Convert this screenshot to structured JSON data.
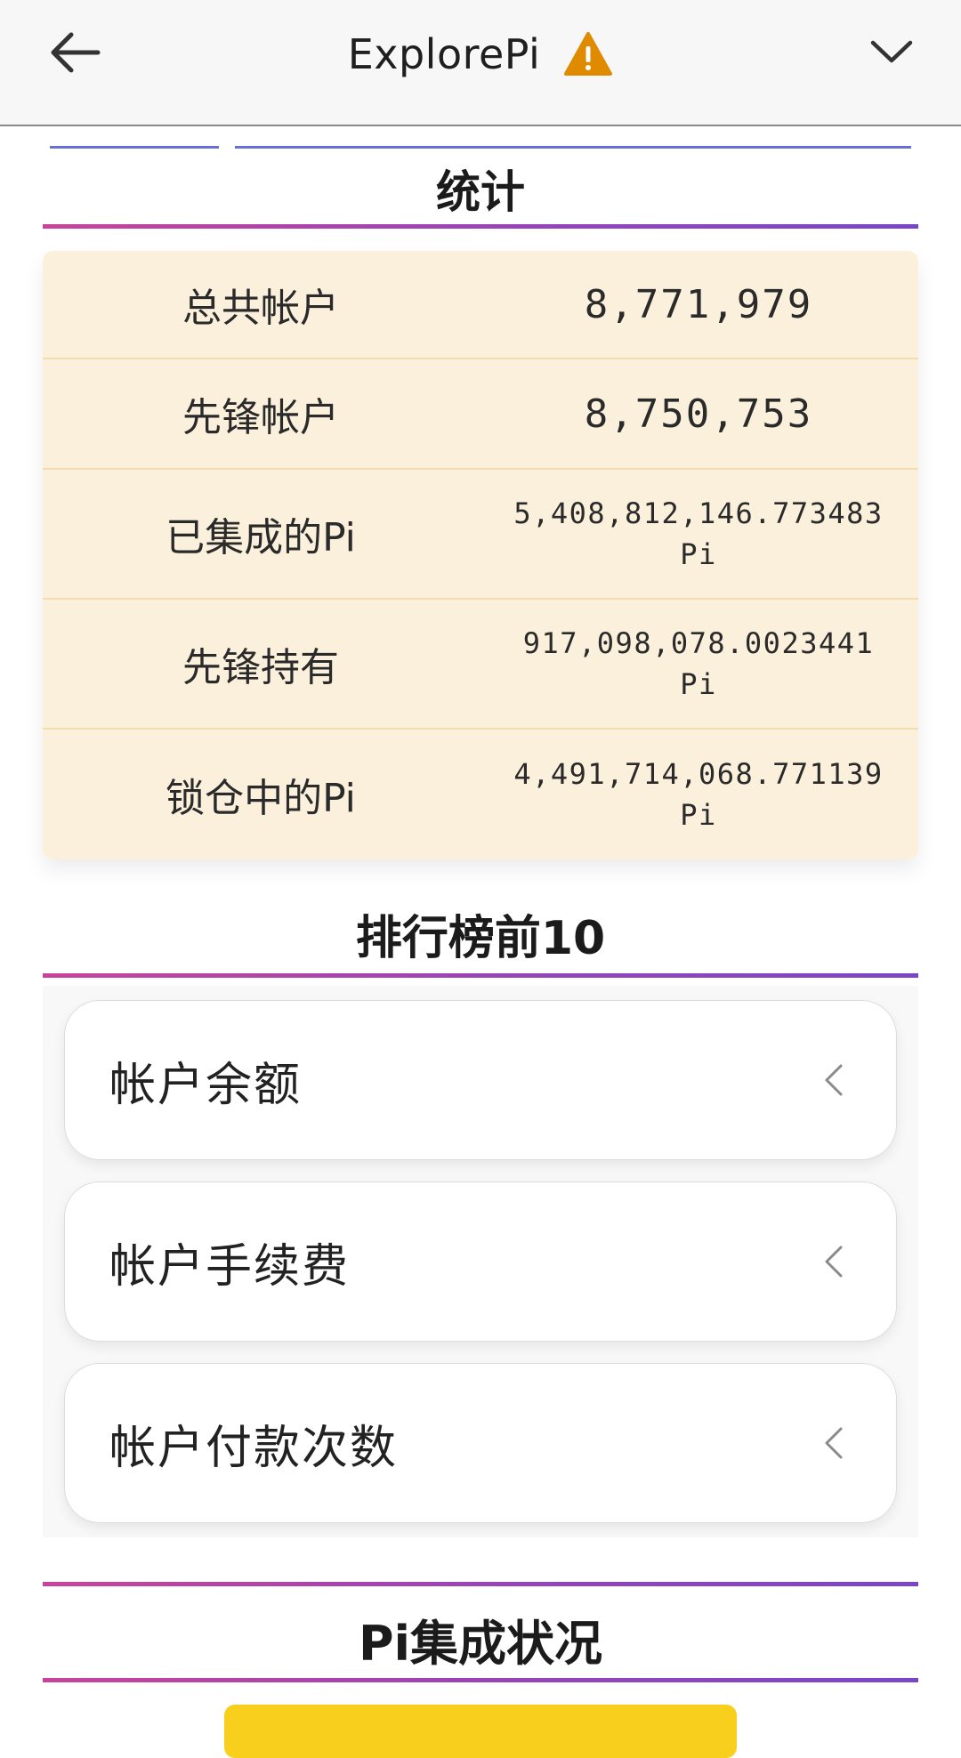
{
  "header": {
    "title": "ExplorePi",
    "back_icon": "arrow-left-icon",
    "warning_icon": "warning-icon",
    "menu_icon": "chevron-down-icon"
  },
  "stats": {
    "title": "统计",
    "rows": [
      {
        "label": "总共帐户",
        "value": "8,771,979"
      },
      {
        "label": "先锋帐户",
        "value": "8,750,753"
      },
      {
        "label": "已集成的Pi",
        "value": "5,408,812,146.773483",
        "unit": "Pi"
      },
      {
        "label": "先锋持有",
        "value": "917,098,078.0023441",
        "unit": "Pi"
      },
      {
        "label": "锁仓中的Pi",
        "value": "4,491,714,068.771139",
        "unit": "Pi"
      }
    ]
  },
  "leaderboard": {
    "title": "排行榜前10",
    "items": [
      {
        "label": "帐户余额"
      },
      {
        "label": "帐户手续费"
      },
      {
        "label": "帐户付款次数"
      }
    ]
  },
  "integration": {
    "title": "Pi集成状况"
  },
  "colors": {
    "accent_gradient_start": "#c8449b",
    "accent_gradient_end": "#7a46c8",
    "stats_bg": "#fbf0dc",
    "warning": "#e08a00",
    "button_yellow": "#f8cf1c"
  }
}
